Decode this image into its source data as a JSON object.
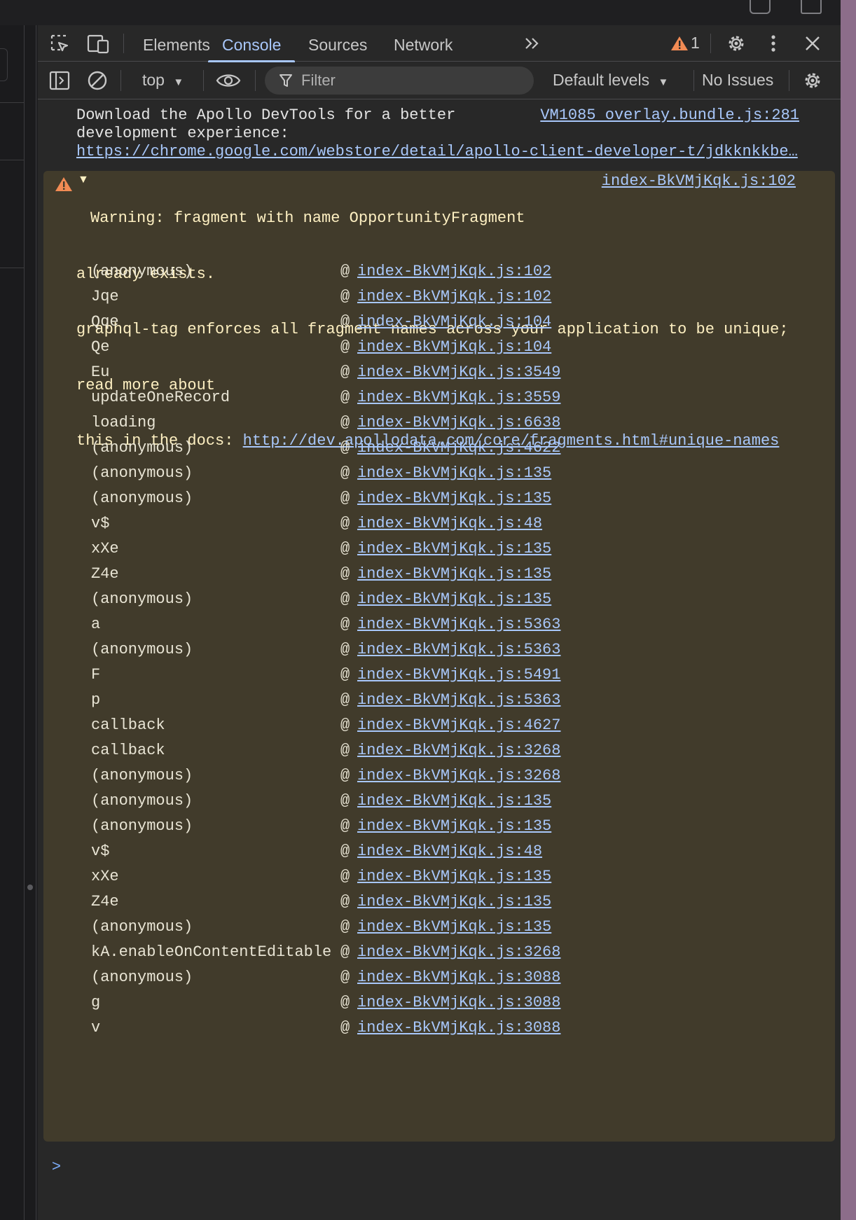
{
  "tabs": [
    "Elements",
    "Console",
    "Sources",
    "Network"
  ],
  "active_tab": "Console",
  "more_tabs_label": ">>",
  "warning_count": "1",
  "toolbar": {
    "context": "top",
    "filter_placeholder": "Filter",
    "levels": "Default levels",
    "issues": "No Issues"
  },
  "messages": {
    "info": {
      "text_line1": "Download the Apollo DevTools for a better",
      "text_line2": "development experience:",
      "url": "https://chrome.google.com/webstore/detail/apollo-client-developer-t/jdkknkkbe…",
      "source": "VM1085 overlay.bundle.js:281"
    },
    "warning": {
      "line1": "Warning: fragment with name OpportunityFragment",
      "line2": "already exists.",
      "line3": "graphql-tag enforces all fragment names across your application to be unique;",
      "line4": "read more about",
      "line5_prefix": "this in the docs: ",
      "docs_url": "http://dev.apollodata.com/core/fragments.html#unique-names",
      "source": "index-BkVMjKqk.js:102"
    }
  },
  "stack": [
    {
      "fn": "(anonymous)",
      "loc": "index-BkVMjKqk.js:102"
    },
    {
      "fn": "Jqe",
      "loc": "index-BkVMjKqk.js:102"
    },
    {
      "fn": "Qqe",
      "loc": "index-BkVMjKqk.js:104"
    },
    {
      "fn": "Qe",
      "loc": "index-BkVMjKqk.js:104"
    },
    {
      "fn": "Eu",
      "loc": "index-BkVMjKqk.js:3549"
    },
    {
      "fn": "updateOneRecord",
      "loc": "index-BkVMjKqk.js:3559"
    },
    {
      "fn": "loading",
      "loc": "index-BkVMjKqk.js:6638"
    },
    {
      "fn": "(anonymous)",
      "loc": "index-BkVMjKqk.js:4622"
    },
    {
      "fn": "(anonymous)",
      "loc": "index-BkVMjKqk.js:135"
    },
    {
      "fn": "(anonymous)",
      "loc": "index-BkVMjKqk.js:135"
    },
    {
      "fn": "v$",
      "loc": "index-BkVMjKqk.js:48"
    },
    {
      "fn": "xXe",
      "loc": "index-BkVMjKqk.js:135"
    },
    {
      "fn": "Z4e",
      "loc": "index-BkVMjKqk.js:135"
    },
    {
      "fn": "(anonymous)",
      "loc": "index-BkVMjKqk.js:135"
    },
    {
      "fn": "a",
      "loc": "index-BkVMjKqk.js:5363"
    },
    {
      "fn": "(anonymous)",
      "loc": "index-BkVMjKqk.js:5363"
    },
    {
      "fn": "F",
      "loc": "index-BkVMjKqk.js:5491"
    },
    {
      "fn": "p",
      "loc": "index-BkVMjKqk.js:5363"
    },
    {
      "fn": "callback",
      "loc": "index-BkVMjKqk.js:4627"
    },
    {
      "fn": "callback",
      "loc": "index-BkVMjKqk.js:3268"
    },
    {
      "fn": "(anonymous)",
      "loc": "index-BkVMjKqk.js:3268"
    },
    {
      "fn": "(anonymous)",
      "loc": "index-BkVMjKqk.js:135"
    },
    {
      "fn": "(anonymous)",
      "loc": "index-BkVMjKqk.js:135"
    },
    {
      "fn": "v$",
      "loc": "index-BkVMjKqk.js:48"
    },
    {
      "fn": "xXe",
      "loc": "index-BkVMjKqk.js:135"
    },
    {
      "fn": "Z4e",
      "loc": "index-BkVMjKqk.js:135"
    },
    {
      "fn": "(anonymous)",
      "loc": "index-BkVMjKqk.js:135"
    },
    {
      "fn": "kA.enableOnContentEditable",
      "loc": "index-BkVMjKqk.js:3268"
    },
    {
      "fn": "(anonymous)",
      "loc": "index-BkVMjKqk.js:3088"
    },
    {
      "fn": "g",
      "loc": "index-BkVMjKqk.js:3088"
    },
    {
      "fn": "v",
      "loc": "index-BkVMjKqk.js:3088"
    }
  ],
  "at_symbol": "@",
  "prompt_glyph": ">",
  "colors": {
    "accent": "#a8c7fa",
    "warning_bg": "#413b2b",
    "warning_icon": "#f28b54"
  }
}
